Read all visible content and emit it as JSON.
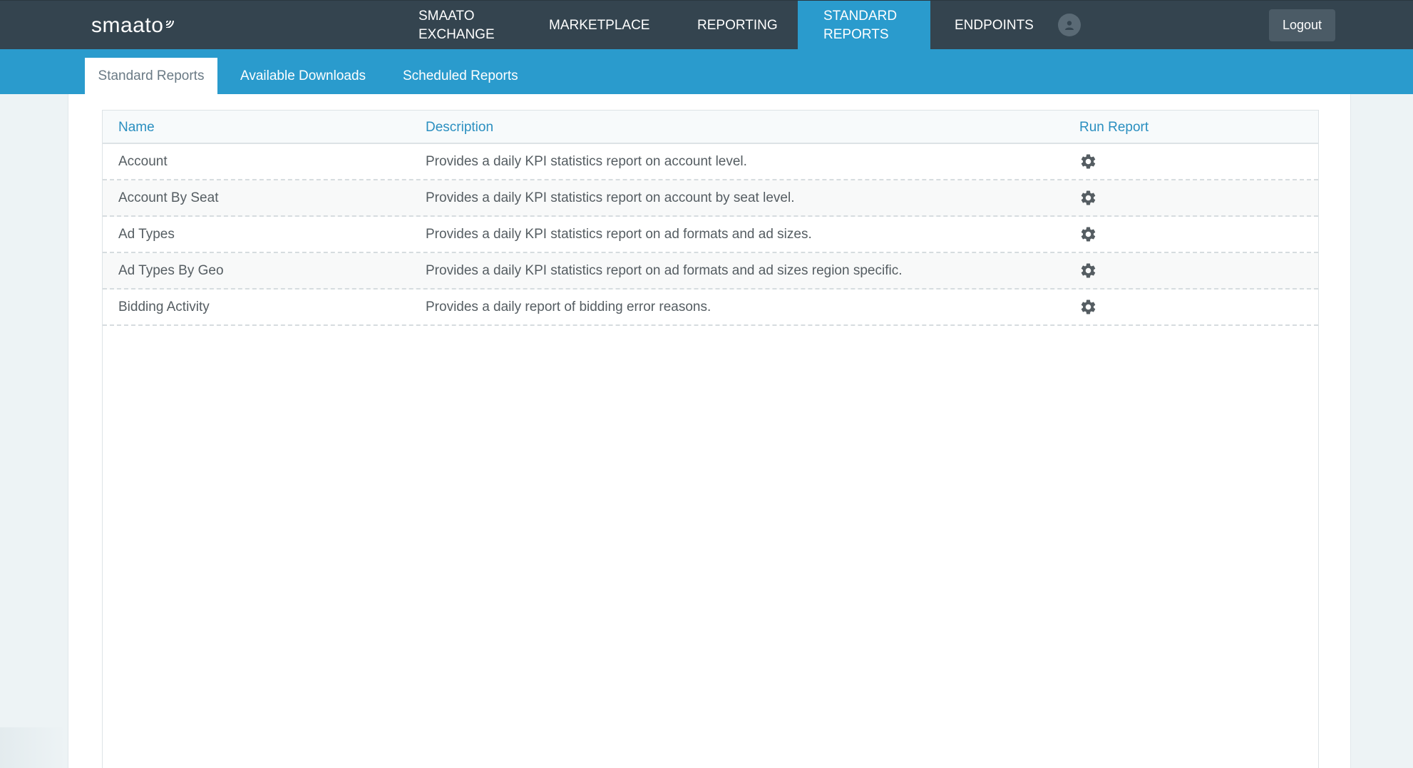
{
  "app": {
    "logo_text": "smaato",
    "logout_label": "Logout"
  },
  "nav": {
    "items": [
      {
        "label": "SMAATO\nEXCHANGE",
        "active": false
      },
      {
        "label": "MARKETPLACE",
        "active": false
      },
      {
        "label": "REPORTING",
        "active": false
      },
      {
        "label": "STANDARD\nREPORTS",
        "active": true
      },
      {
        "label": "ENDPOINTS",
        "active": false
      }
    ],
    "user_icon": "user-icon"
  },
  "subnav": {
    "tabs": [
      {
        "label": "Standard Reports",
        "active": true
      },
      {
        "label": "Available Downloads",
        "active": false
      },
      {
        "label": "Scheduled Reports",
        "active": false
      }
    ]
  },
  "table": {
    "headers": {
      "name": "Name",
      "description": "Description",
      "run": "Run Report"
    },
    "rows": [
      {
        "name": "Account",
        "description": "Provides a daily KPI statistics report on account level.",
        "run_icon": "gear-icon"
      },
      {
        "name": "Account By Seat",
        "description": "Provides a daily KPI statistics report on account by seat level.",
        "run_icon": "gear-icon"
      },
      {
        "name": "Ad Types",
        "description": "Provides a daily KPI statistics report on ad formats and ad sizes.",
        "run_icon": "gear-icon"
      },
      {
        "name": "Ad Types By Geo",
        "description": "Provides a daily KPI statistics report on ad formats and ad sizes region specific.",
        "run_icon": "gear-icon"
      },
      {
        "name": "Bidding Activity",
        "description": "Provides a daily report of bidding error reasons.",
        "run_icon": "gear-icon"
      }
    ]
  },
  "colors": {
    "topbar": "#34444f",
    "accent": "#2a9bcd",
    "header_text": "#2a8fc0",
    "body_text": "#555d62"
  }
}
